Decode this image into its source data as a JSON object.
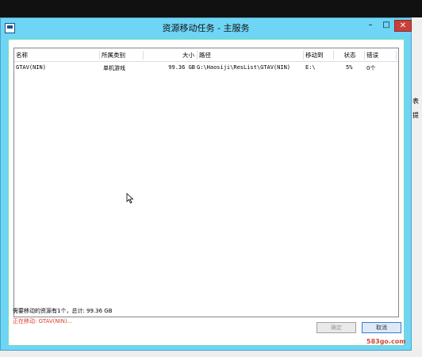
{
  "window": {
    "title": "资源移动任务 - 主服务",
    "min": "–",
    "max": "□",
    "close": "✕"
  },
  "table": {
    "columns": [
      "名称",
      "所属类别",
      "大小",
      "路径",
      "移动到",
      "状态",
      "错误"
    ],
    "rows": [
      [
        "GTAV(NIN)",
        "单机游戏",
        "99.36 GB",
        "G:\\Haosiji\\ResList\\GTAV(NIN)",
        "E:\\",
        "5%",
        "0个"
      ]
    ]
  },
  "status": {
    "summary": "需要移动的资源有1个，总计: 99.36 GB",
    "moving": "正在移动: GTAV(NIN)..."
  },
  "buttons": {
    "ok": "确定",
    "cancel": "取消"
  },
  "watermark": "583go.com",
  "side_fragments": [
    "表",
    "提"
  ]
}
